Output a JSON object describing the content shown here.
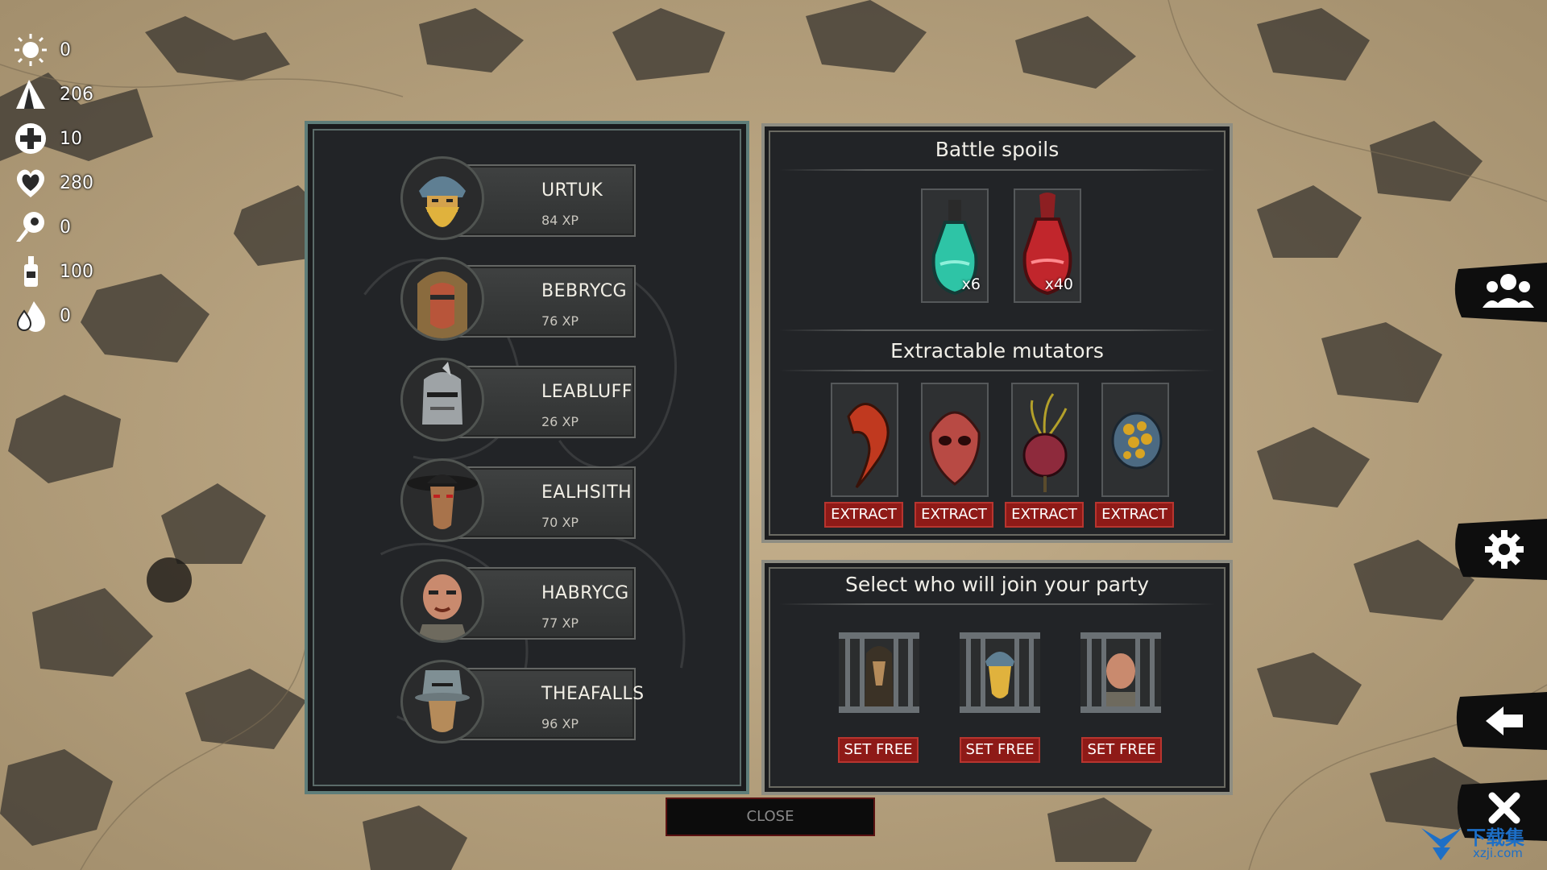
{
  "resources": [
    {
      "icon": "sun-icon",
      "value": "0"
    },
    {
      "icon": "tent-icon",
      "value": "206"
    },
    {
      "icon": "medical-cross-icon",
      "value": "10"
    },
    {
      "icon": "heart-icon",
      "value": "280"
    },
    {
      "icon": "meat-icon",
      "value": "0"
    },
    {
      "icon": "bottle-icon",
      "value": "100"
    },
    {
      "icon": "drops-icon",
      "value": "0"
    }
  ],
  "heroes": [
    {
      "name": "URTUK",
      "xp": "84 XP"
    },
    {
      "name": "BEBRYCG",
      "xp": "76 XP"
    },
    {
      "name": "LEABLUFF",
      "xp": "26 XP"
    },
    {
      "name": "EALHSITH",
      "xp": "70 XP"
    },
    {
      "name": "HABRYCG",
      "xp": "77 XP"
    },
    {
      "name": "THEAFALLS",
      "xp": "96 XP"
    }
  ],
  "spoils": {
    "title": "Battle spoils",
    "items": [
      {
        "icon": "teal-potion-icon",
        "count": "x6",
        "color": "#2ec4a6"
      },
      {
        "icon": "red-potion-icon",
        "count": "x40",
        "color": "#c1262c"
      }
    ]
  },
  "mutators": {
    "title": "Extractable mutators",
    "button_label": "EXTRACT",
    "items": [
      {
        "icon": "red-tentacle-icon"
      },
      {
        "icon": "skull-mask-icon"
      },
      {
        "icon": "spiked-heart-icon"
      },
      {
        "icon": "golden-orb-icon"
      }
    ]
  },
  "party": {
    "title": "Select who will join your party",
    "button_label": "SET FREE",
    "prisoners": [
      {
        "icon": "caged-hooded-icon"
      },
      {
        "icon": "caged-helmet-icon"
      },
      {
        "icon": "caged-bald-icon"
      }
    ]
  },
  "side_buttons": [
    "party-icon",
    "gear-icon",
    "back-arrow-icon",
    "close-x-icon"
  ],
  "close_label": "CLOSE",
  "watermark": {
    "line1": "下载集",
    "line2": "xzji.com"
  }
}
